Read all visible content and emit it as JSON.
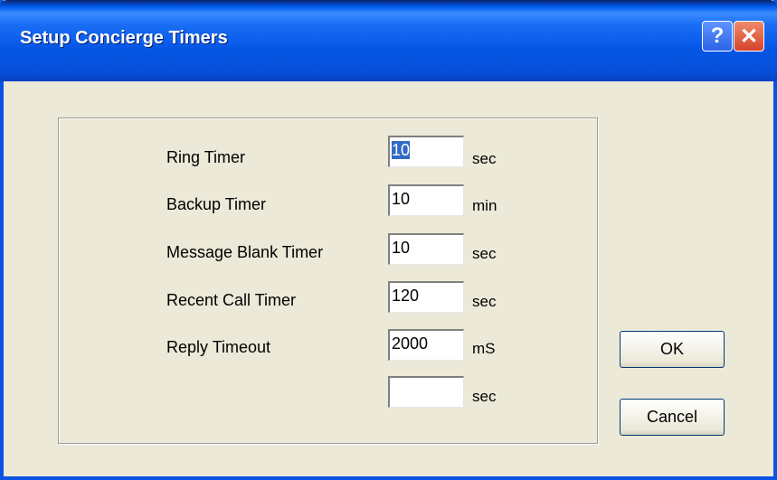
{
  "window": {
    "title": "Setup Concierge Timers"
  },
  "title_buttons": {
    "help_label": "?",
    "close_label": "✕"
  },
  "timers": [
    {
      "label": "Ring Timer",
      "value": "10",
      "unit": "sec",
      "selected": true
    },
    {
      "label": "Backup Timer",
      "value": "10",
      "unit": "min"
    },
    {
      "label": "Message Blank Timer",
      "value": "10",
      "unit": "sec"
    },
    {
      "label": "Recent Call Timer",
      "value": "120",
      "unit": "sec"
    },
    {
      "label": "Reply Timeout",
      "value": "2000",
      "unit": "mS"
    },
    {
      "label": "",
      "value": "",
      "unit": "sec"
    }
  ],
  "buttons": {
    "ok_label": "OK",
    "cancel_label": "Cancel"
  },
  "colors": {
    "titlebar": "#0556e6",
    "dialog_bg": "#ece9d8",
    "selection": "#316ac5",
    "close_button": "#d5432b"
  }
}
